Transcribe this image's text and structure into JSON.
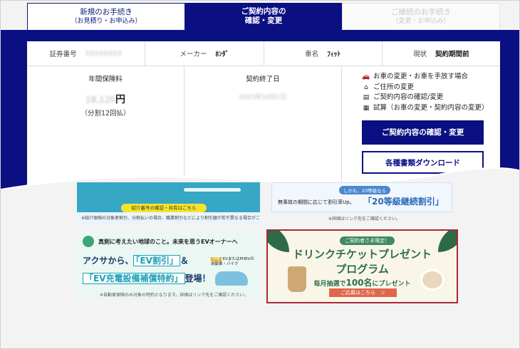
{
  "tabs": [
    {
      "title": "新規のお手続き",
      "sub": "（お見積り・お申込み）"
    },
    {
      "title": "ご契約内容の",
      "sub": "確認・変更"
    },
    {
      "title": "ご継続のお手続き",
      "sub": "（変更・お申込み）"
    }
  ],
  "contract": {
    "policy_label": "証券番号",
    "policy_value": "XXXXXXXX",
    "maker_label": "メーカー",
    "maker_value": "ﾎﾝﾀﾞ",
    "car_label": "車名",
    "car_value": "ﾌｨｯﾄ",
    "status_label": "現状",
    "status_value": "契約期間前",
    "premium_label": "年間保険料",
    "premium_amount": "18,120",
    "premium_unit": "円",
    "installment": "（分割12回払）",
    "end_label": "契約終了日",
    "end_value": "2023年10月1日"
  },
  "links": [
    {
      "icon": "car-icon",
      "glyph": "🚗",
      "label": "お車の変更・お車を手放す場合"
    },
    {
      "icon": "home-icon",
      "glyph": "⌂",
      "label": "ご住所の変更"
    },
    {
      "icon": "document-icon",
      "glyph": "▤",
      "label": "ご契約内容の確認/変更"
    },
    {
      "icon": "calculator-icon",
      "glyph": "▦",
      "label": "試算（お車の変更・契約内容の変更）"
    }
  ],
  "buttons": {
    "confirm_change": "ご契約内容の確認・変更",
    "download": "各種書類ダウンロード"
  },
  "banners": {
    "referral_pill": "紹介番号の確認・共有はこちら",
    "referral_note": "※紹介保険の対象者割引、分割払いの場合、職業割引などにより割引額が若干異なる場合がございます。",
    "grade_tag": "しかも、20等級なら",
    "grade_text": "無事故の期間に応じて割引率Up。",
    "grade_big": "「20等級継続割引」",
    "grade_note": "※詳細はリンク先をご確認ください。",
    "ev_head": "真剣に考えたい地球のこと。未来を思うEVオーナーへ",
    "ev_line1_pre": "アクサから、",
    "ev_line1_hl": "「EV割引」",
    "ev_line1_post": "＆",
    "ev_line2_hl": "「EV充電設備補償特約」",
    "ev_line2_post": "登場！",
    "ev_badge": "対象",
    "ev_target": "EVまたはPHEVの",
    "ev_target2": "自動車・バイク",
    "ev_note": "※自動車保険のみ対象の特約となります。詳細はリンク先をご確認ください。",
    "drink_tag": "ご契約者さま限定！",
    "drink_t1": "ドリンクチケットプレゼント",
    "drink_t2": "プログラム",
    "drink_t3_pre": "毎月抽選で",
    "drink_t3_em": "100名",
    "drink_t3_post": "にプレゼント",
    "drink_cta": "ご応募はこちら　＞"
  }
}
